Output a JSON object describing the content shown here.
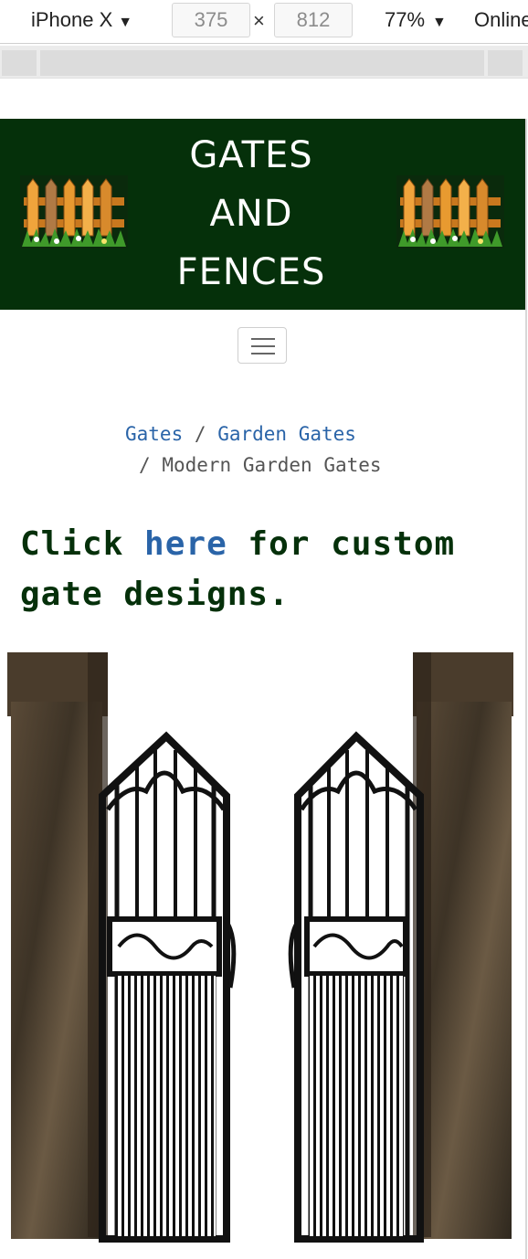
{
  "devtools": {
    "device": "iPhone X",
    "width": "375",
    "times": "×",
    "height": "812",
    "zoom": "77%",
    "throttle": "Online"
  },
  "header": {
    "title_lines": [
      "GATES",
      "AND",
      "FENCES"
    ],
    "background": "#05300a",
    "logo_icon": "picket-fence-icon"
  },
  "nav": {
    "toggle_icon": "hamburger-menu-icon"
  },
  "breadcrumb": {
    "items": [
      "Gates",
      "Garden Gates",
      "Modern Garden Gates"
    ],
    "separator": "/",
    "link_color": "#2a64a8"
  },
  "cta": {
    "before": "Click ",
    "link": "here",
    "after": " for custom gate designs.",
    "color": "#05300a"
  },
  "hero": {
    "image": "open-iron-garden-gate-with-stone-pillars"
  }
}
